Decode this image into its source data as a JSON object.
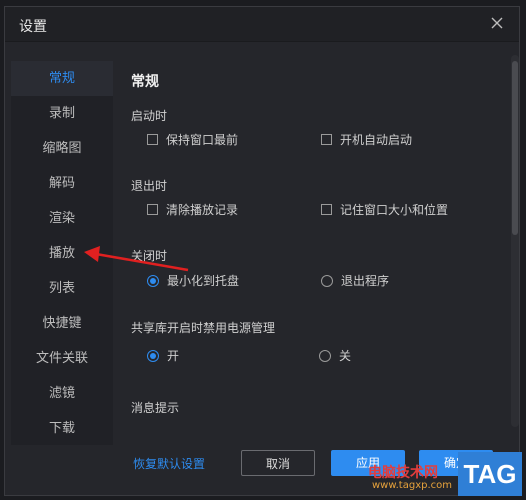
{
  "window": {
    "title": "设置"
  },
  "sidebar": {
    "items": [
      {
        "label": "常规",
        "active": true
      },
      {
        "label": "录制"
      },
      {
        "label": "缩略图"
      },
      {
        "label": "解码"
      },
      {
        "label": "渲染"
      },
      {
        "label": "播放"
      },
      {
        "label": "列表"
      },
      {
        "label": "快捷键"
      },
      {
        "label": "文件关联"
      },
      {
        "label": "滤镜"
      },
      {
        "label": "下载"
      }
    ]
  },
  "content": {
    "section_title": "常规",
    "startup": {
      "label": "启动时",
      "opt1": "保持窗口最前",
      "opt2": "开机自动启动"
    },
    "exit": {
      "label": "退出时",
      "opt1": "清除播放记录",
      "opt2": "记住窗口大小和位置"
    },
    "close": {
      "label": "关闭时",
      "opt1": "最小化到托盘",
      "opt2": "退出程序",
      "selected": "最小化到托盘"
    },
    "power": {
      "label": "共享库开启时禁用电源管理",
      "opt_on": "开",
      "opt_off": "关",
      "selected": "开"
    },
    "notify": {
      "label": "消息提示"
    }
  },
  "footer": {
    "restore_label": "恢复默认设置",
    "cancel_label": "取消",
    "apply_label": "应用",
    "ok_label": "确定"
  },
  "watermark": {
    "site_name": "电脑技术网",
    "url": "www.tagxp.com",
    "tag": "TAG"
  },
  "colors": {
    "accent": "#2e8cf0",
    "arrow": "#e02020"
  }
}
